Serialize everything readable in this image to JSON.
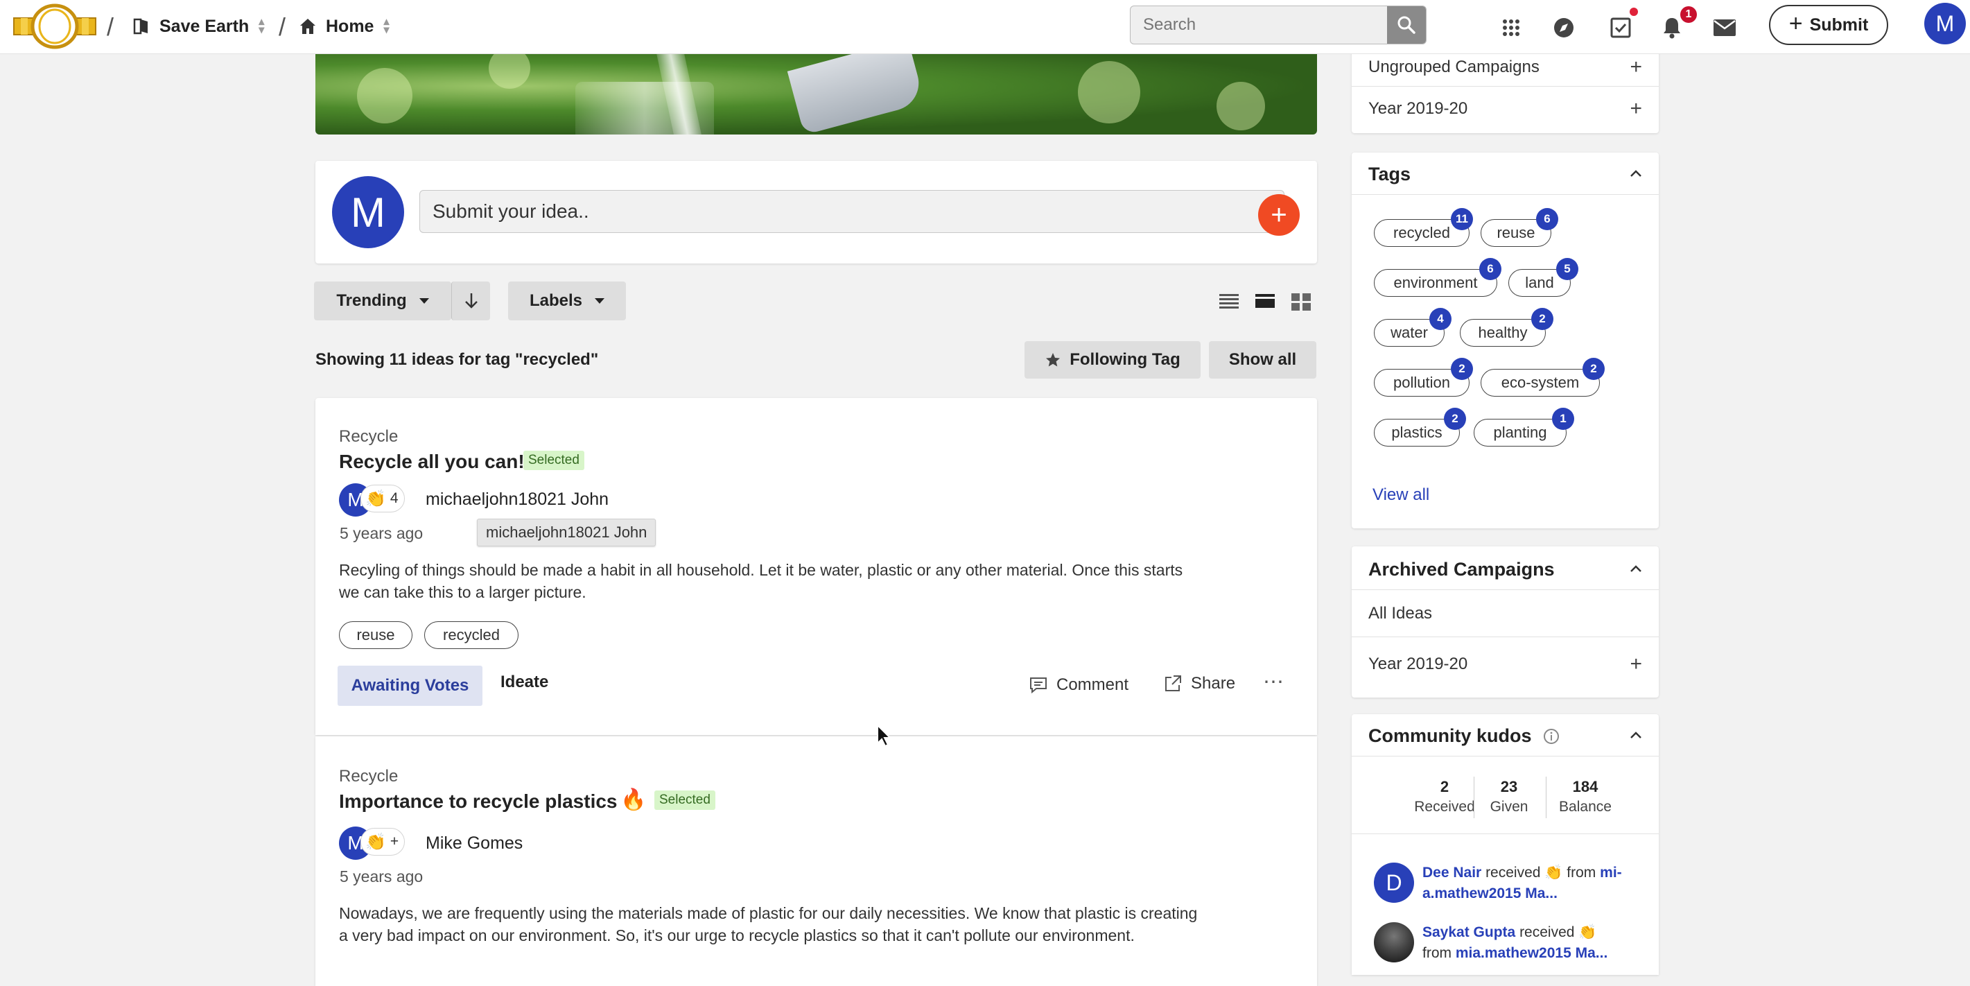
{
  "topbar": {
    "breadcrumb": [
      {
        "label": "Save Earth"
      },
      {
        "label": "Home"
      }
    ],
    "search_placeholder": "Search",
    "notification_count": "1",
    "submit_label": "Submit",
    "avatar_initial": "M"
  },
  "idea_box": {
    "avatar_initial": "M",
    "placeholder": "Submit your idea..",
    "add_symbol": "+"
  },
  "filters": {
    "sort_label": "Trending",
    "labels_label": "Labels"
  },
  "results": {
    "showing_text": "Showing 11 ideas for tag \"recycled\"",
    "following_label": "Following Tag",
    "show_all_label": "Show all"
  },
  "posts": [
    {
      "category": "Recycle",
      "title": "Recycle all you can!",
      "badge": "Selected",
      "avatar_initial": "M",
      "claps": "4",
      "author": "michaeljohn18021 John",
      "tooltip": "michaeljohn18021 John",
      "time": "5 years ago",
      "body_line1": "Recyling of things should be made a habit in all household. Let it be water, plastic or any other material. Once this starts",
      "body_line2": "we can take this to a larger picture.",
      "tags": [
        "reuse",
        "recycled"
      ],
      "stage": "Awaiting Votes",
      "stage_next": "Ideate",
      "comment_label": "Comment",
      "share_label": "Share",
      "more_label": "⋯"
    },
    {
      "category": "Recycle",
      "title": "Importance to recycle plastics",
      "badge": "Selected",
      "avatar_initial": "M",
      "claps": "+",
      "author": "Mike Gomes",
      "time": "5 years ago",
      "body_line1": "Nowadays, we are frequently using the materials made of plastic for our daily necessities. We know that plastic is creating",
      "body_line2": "a very bad impact on our environment. So, it's our urge to recycle plastics so that it can't pollute our environment."
    }
  ],
  "sidebar": {
    "campaign_rows": [
      {
        "label": "Ungrouped Campaigns"
      },
      {
        "label": "Year 2019-20"
      }
    ],
    "tags_title": "Tags",
    "tags": [
      {
        "label": "recycled",
        "count": "11"
      },
      {
        "label": "reuse",
        "count": "6"
      },
      {
        "label": "environment",
        "count": "6"
      },
      {
        "label": "land",
        "count": "5"
      },
      {
        "label": "water",
        "count": "4"
      },
      {
        "label": "healthy",
        "count": "2"
      },
      {
        "label": "pollution",
        "count": "2"
      },
      {
        "label": "eco-system",
        "count": "2"
      },
      {
        "label": "plastics",
        "count": "2"
      },
      {
        "label": "planting",
        "count": "1"
      }
    ],
    "view_all_label": "View all",
    "archived_title": "Archived Campaigns",
    "archived_rows": [
      {
        "label": "All Ideas"
      },
      {
        "label": "Year 2019-20"
      }
    ],
    "kudos_title": "Community kudos",
    "kudos_stats": [
      {
        "value": "2",
        "label": "Received"
      },
      {
        "value": "23",
        "label": "Given"
      },
      {
        "value": "184",
        "label": "Balance"
      }
    ],
    "kudos_feed": [
      {
        "avatar_initial": "D",
        "name": "Dee Nair",
        "verb": "received",
        "from_word": "from",
        "from_user_1": "mi-",
        "from_user_2": "a.mathew2015 Ma..."
      },
      {
        "name": "Saykat Gupta",
        "verb": "received",
        "from_word": "from",
        "from_user_2": "mia.mathew2015 Ma..."
      }
    ]
  },
  "colors": {
    "brand_blue": "#2840b8",
    "accent_orange": "#f04a23",
    "selected_bg": "#d8f5c9"
  }
}
